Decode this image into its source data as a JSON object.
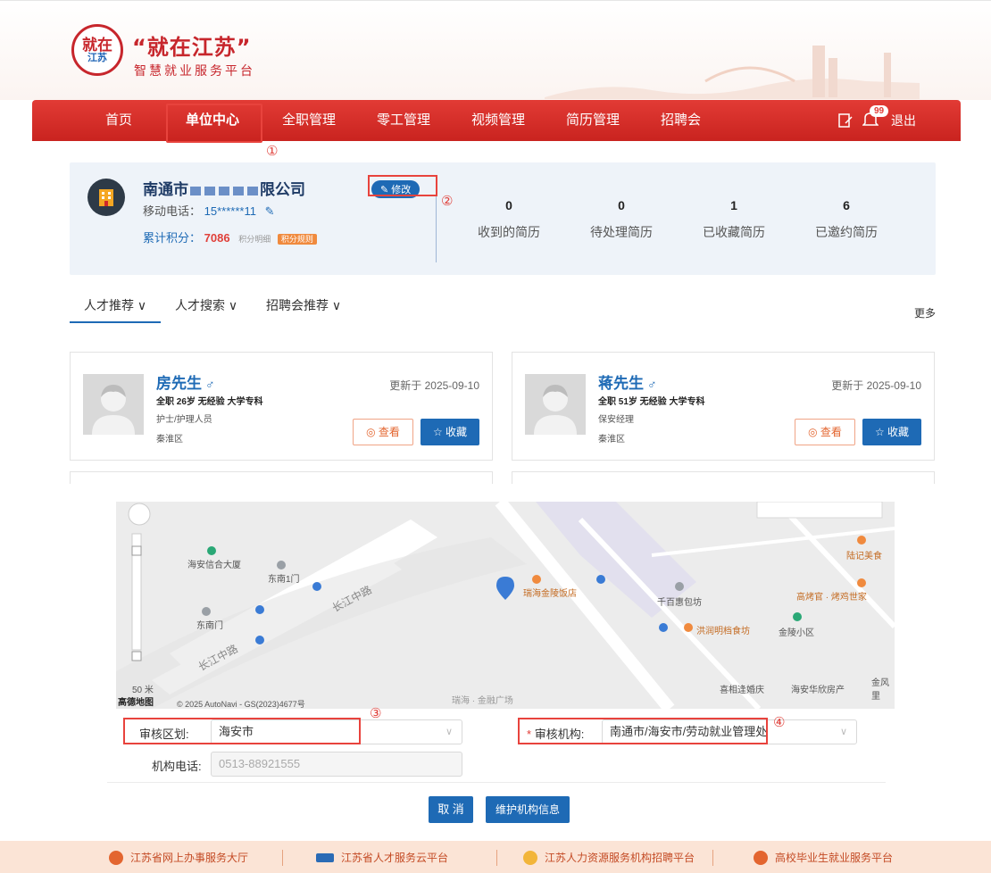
{
  "header": {
    "logo_circle_top": "就在",
    "logo_circle_bottom": "江苏",
    "title": "“就在江苏”",
    "subtitle": "智慧就业服务平台"
  },
  "nav": {
    "items": [
      "首页",
      "单位中心",
      "全职管理",
      "零工管理",
      "视频管理",
      "简历管理",
      "招聘会"
    ],
    "active": "单位中心",
    "badge": "99",
    "logout": "退出"
  },
  "annotations": [
    "①",
    "②",
    "③",
    "④"
  ],
  "profile": {
    "company_prefix": "南通市",
    "company_suffix": "限公司",
    "phone_label": "移动电话：",
    "phone_value": "15******11",
    "points_label": "累计积分：",
    "points_value": "7086",
    "points_detail": "积分明细",
    "points_rule": "积分规则",
    "edit_label": "修改",
    "stats": [
      {
        "value": "0",
        "label": "收到的简历"
      },
      {
        "value": "0",
        "label": "待处理简历"
      },
      {
        "value": "1",
        "label": "已收藏简历"
      },
      {
        "value": "6",
        "label": "已邀约简历"
      }
    ]
  },
  "tabs": {
    "items": [
      "人才推荐 ∨",
      "人才搜索 ∨",
      "招聘会推荐 ∨"
    ],
    "more": "更多"
  },
  "cards": [
    {
      "name": "房先生",
      "gender": "♂",
      "meta": "全职  26岁  无经验  大学专科",
      "job": "护士/护理人员",
      "area": "秦淮区",
      "updated": "更新于 2025-09-10",
      "view": "查看",
      "fav": "收藏"
    },
    {
      "name": "蒋先生",
      "gender": "♂",
      "meta": "全职  51岁  无经验  大学专科",
      "job": "保安经理",
      "area": "秦淮区",
      "updated": "更新于 2025-09-10",
      "view": "查看",
      "fav": "收藏"
    }
  ],
  "map": {
    "labels": {
      "haian_xinxin": "海安信合大厦",
      "dongnan1": "东南1门",
      "dongnan": "东南门",
      "changjiang_road_1": "长江中路",
      "changjiang_road_2": "长江中路",
      "ruihai_hotel": "瑞海金陵饭店",
      "qianbaihui": "千百惠包坊",
      "hongrun": "洪润明档食坊",
      "jinling": "金陵小区",
      "luji": "陆记美食",
      "gaokaoguan": "高烤官 · 烤鸡世家",
      "ruihai_plaza": "瑞海 · 金融广场",
      "xixiang": "喜相逢婚庆",
      "haian_huaxin": "海安华欣房产",
      "jinfeng": "金风里",
      "scale": "50 米",
      "copyright": "© 2025 AutoNavi - GS(2023)4677号",
      "brand": "高德地图"
    }
  },
  "form": {
    "region_label": "审核区划:",
    "region_value": "海安市",
    "org_label": "审核机构:",
    "org_required": "*",
    "org_value": "南通市/海安市/劳动就业管理处",
    "phone_label": "机构电话:",
    "phone_value": "0513-88921555",
    "cancel": "取 消",
    "maintain": "维护机构信息"
  },
  "footer": {
    "items": [
      "江苏省网上办事服务大厅",
      "江苏省人才服务云平台",
      "江苏人力资源服务机构招聘平台",
      "高校毕业生就业服务平台"
    ]
  },
  "colors": {
    "brand_red": "#d0282a",
    "brand_blue": "#1e6ab5",
    "annotation_red": "#e8433d"
  }
}
